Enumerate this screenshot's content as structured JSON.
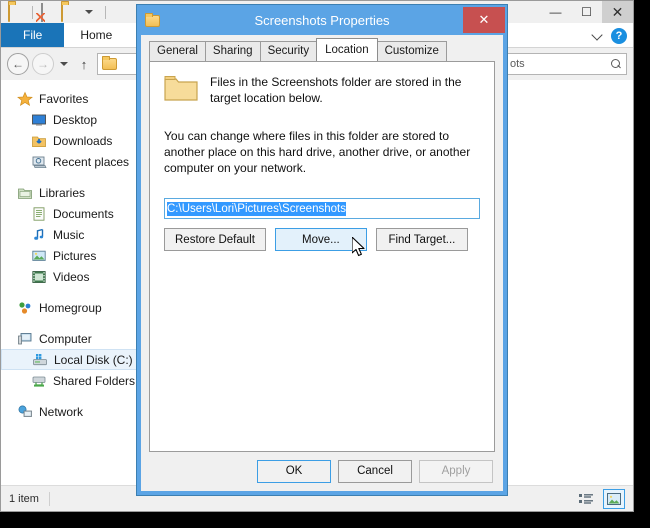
{
  "explorer": {
    "quick_access": {
      "items": [
        "folder-icon",
        "new-folder-icon",
        "properties-icon",
        "customize-qat-icon"
      ]
    },
    "window_controls": {
      "minimize": "—",
      "maximize": "☐",
      "close": "✕"
    },
    "ribbon": {
      "tabs": [
        {
          "label": "File",
          "active": false,
          "accent": "#1a74b8"
        },
        {
          "label": "Home",
          "active": true
        }
      ],
      "collapse_icon": "chevron-down-icon",
      "help_icon": "?"
    },
    "navigation": {
      "back": "←",
      "forward": "→",
      "recent_dropdown": "▾",
      "up": "↑",
      "address_value": "",
      "search_value": "ots",
      "search_icon": "search-icon"
    },
    "sidebar": {
      "groups": [
        {
          "header": {
            "label": "Favorites",
            "icon": "star-icon"
          },
          "items": [
            {
              "label": "Desktop",
              "icon": "desktop-icon"
            },
            {
              "label": "Downloads",
              "icon": "downloads-icon"
            },
            {
              "label": "Recent places",
              "icon": "recent-places-icon"
            }
          ]
        },
        {
          "header": {
            "label": "Libraries",
            "icon": "libraries-icon"
          },
          "items": [
            {
              "label": "Documents",
              "icon": "documents-icon"
            },
            {
              "label": "Music",
              "icon": "music-icon"
            },
            {
              "label": "Pictures",
              "icon": "pictures-icon"
            },
            {
              "label": "Videos",
              "icon": "videos-icon"
            }
          ]
        },
        {
          "header": {
            "label": "Homegroup",
            "icon": "homegroup-icon"
          },
          "items": []
        },
        {
          "header": {
            "label": "Computer",
            "icon": "computer-icon"
          },
          "items": [
            {
              "label": "Local Disk (C:)",
              "icon": "local-disk-icon",
              "selected": true
            },
            {
              "label": "Shared Folders",
              "icon": "shared-folders-icon"
            }
          ]
        },
        {
          "header": {
            "label": "Network",
            "icon": "network-icon"
          },
          "items": []
        }
      ]
    },
    "status_bar": {
      "item_count": "1 item",
      "views": [
        {
          "name": "details-view",
          "active": false
        },
        {
          "name": "large-icons-view",
          "active": true
        }
      ]
    }
  },
  "dialog": {
    "title": "Screenshots Properties",
    "title_icon": "folder-icon",
    "close_label": "✕",
    "accent_color": "#5ba4e5",
    "close_color": "#c75050",
    "tabs": [
      {
        "label": "General",
        "active": false
      },
      {
        "label": "Sharing",
        "active": false
      },
      {
        "label": "Security",
        "active": false
      },
      {
        "label": "Location",
        "active": true
      },
      {
        "label": "Customize",
        "active": false
      }
    ],
    "location_tab": {
      "icon": "folder-icon",
      "intro": "Files in the Screenshots folder are stored in the target location below.",
      "description": "You can change where files in this folder are stored to another place on this hard drive, another drive, or another computer on your network.",
      "path_value": "C:\\Users\\Lori\\Pictures\\Screenshots",
      "path_selected": true,
      "buttons": [
        {
          "label": "Restore Default",
          "state": "normal"
        },
        {
          "label": "Move...",
          "state": "hover"
        },
        {
          "label": "Find Target...",
          "state": "normal"
        }
      ]
    },
    "footer_buttons": [
      {
        "label": "OK",
        "state": "default"
      },
      {
        "label": "Cancel",
        "state": "normal"
      },
      {
        "label": "Apply",
        "state": "disabled"
      }
    ]
  }
}
